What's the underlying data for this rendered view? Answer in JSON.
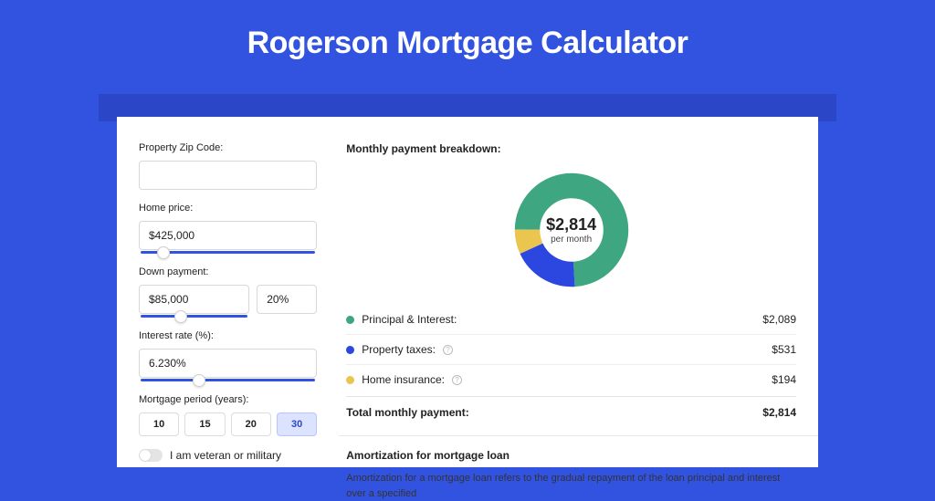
{
  "title": "Rogerson Mortgage Calculator",
  "form": {
    "zip_label": "Property Zip Code:",
    "zip_value": "",
    "home_price_label": "Home price:",
    "home_price_value": "$425,000",
    "home_price_slider_pos_pct": 10,
    "down_payment_label": "Down payment:",
    "down_payment_value": "$85,000",
    "down_payment_pct": "20%",
    "down_payment_slider_pos_pct": 20,
    "interest_label": "Interest rate (%):",
    "interest_value": "6.230%",
    "interest_slider_pos_pct": 30,
    "period_label": "Mortgage period (years):",
    "periods": [
      "10",
      "15",
      "20",
      "30"
    ],
    "period_selected": "30",
    "veteran_label": "I am veteran or military",
    "veteran_on": false
  },
  "breakdown": {
    "title": "Monthly payment breakdown:",
    "donut_amount": "$2,814",
    "donut_sub": "per month",
    "items": [
      {
        "label": "Principal & Interest:",
        "value": "$2,089",
        "color": "#3ea681",
        "info": false,
        "pct": 74
      },
      {
        "label": "Property taxes:",
        "value": "$531",
        "color": "#2b47e0",
        "info": true,
        "pct": 19
      },
      {
        "label": "Home insurance:",
        "value": "$194",
        "color": "#eac54f",
        "info": true,
        "pct": 7
      }
    ],
    "total_label": "Total monthly payment:",
    "total_value": "$2,814"
  },
  "amort": {
    "title": "Amortization for mortgage loan",
    "text": "Amortization for a mortgage loan refers to the gradual repayment of the loan principal and interest over a specified"
  },
  "chart_data": {
    "type": "pie",
    "title": "Monthly payment breakdown",
    "series": [
      {
        "name": "Principal & Interest",
        "value": 2089,
        "color": "#3ea681"
      },
      {
        "name": "Property taxes",
        "value": 531,
        "color": "#2b47e0"
      },
      {
        "name": "Home insurance",
        "value": 194,
        "color": "#eac54f"
      }
    ],
    "total": 2814,
    "center_label": "$2,814 per month"
  }
}
